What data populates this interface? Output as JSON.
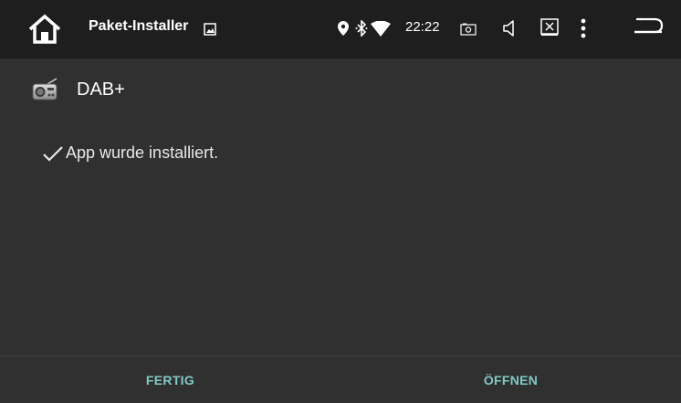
{
  "statusbar": {
    "app_title": "Paket-Installer",
    "time": "22:22",
    "icons": [
      "home-icon",
      "image-notification-icon",
      "location-icon",
      "bluetooth-icon",
      "wifi-icon",
      "screenshot-icon",
      "volume-icon",
      "close-app-icon",
      "more-vert-icon",
      "back-icon"
    ]
  },
  "app": {
    "name": "DAB+",
    "icon": "radio-icon"
  },
  "status": {
    "message": "App wurde installiert.",
    "icon": "check-icon"
  },
  "actions": {
    "done_label": "FERTIG",
    "open_label": "ÖFFNEN"
  },
  "colors": {
    "background": "#303030",
    "statusbar": "#1e1e1e",
    "accent": "#80cbc4"
  }
}
